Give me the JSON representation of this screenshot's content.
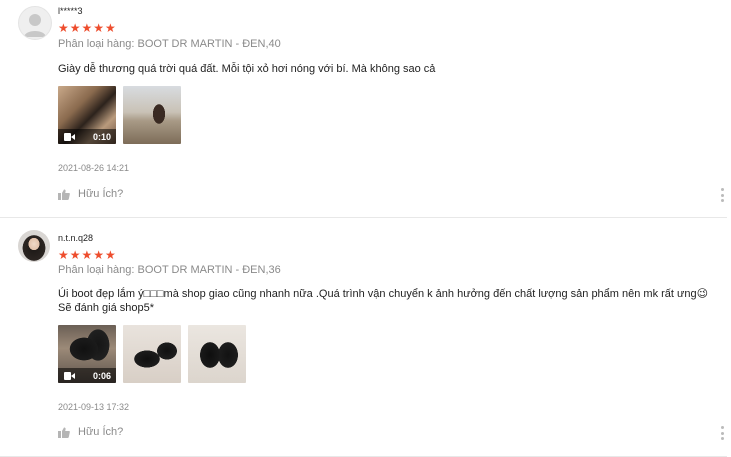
{
  "reviews": [
    {
      "author": "l*****3",
      "rating_stars": "★★★★★",
      "rating": 5,
      "variant": "Phân loại hàng: BOOT DR MARTIN - ĐEN,40",
      "comment": "Giày dễ thương quá trời quá đất. Mỗi tội xỏ hơi nóng với bí. Mà không sao cả",
      "media": [
        {
          "kind": "video",
          "duration": "0:10"
        },
        {
          "kind": "image"
        }
      ],
      "timestamp": "2021-08-26 14:21",
      "helpful_label": "Hữu Ích?"
    },
    {
      "author": "n.t.n.q28",
      "rating_stars": "★★★★★",
      "rating": 5,
      "variant": "Phân loại hàng: BOOT DR MARTIN - ĐEN,36",
      "comment_line1": "Úi boot đẹp lắm ý□□□mà shop giao cũng nhanh nữa .Quá trình vận chuyển k ảnh hưởng đến chất lượng sản phẩm nên mk rất ưng😉",
      "comment_line2": "Sẽ đánh giá shop5*",
      "media": [
        {
          "kind": "video",
          "duration": "0:06"
        },
        {
          "kind": "image"
        },
        {
          "kind": "image"
        }
      ],
      "timestamp": "2021-09-13 17:32",
      "helpful_label": "Hữu Ích?"
    }
  ],
  "colors": {
    "star": "#ee4d2d",
    "muted_text": "#8a8a8a",
    "divider": "#e8e8e8"
  },
  "icons": [
    "user-placeholder-icon",
    "star-icon",
    "video-camera-icon",
    "thumbs-up-icon",
    "more-vertical-icon"
  ]
}
